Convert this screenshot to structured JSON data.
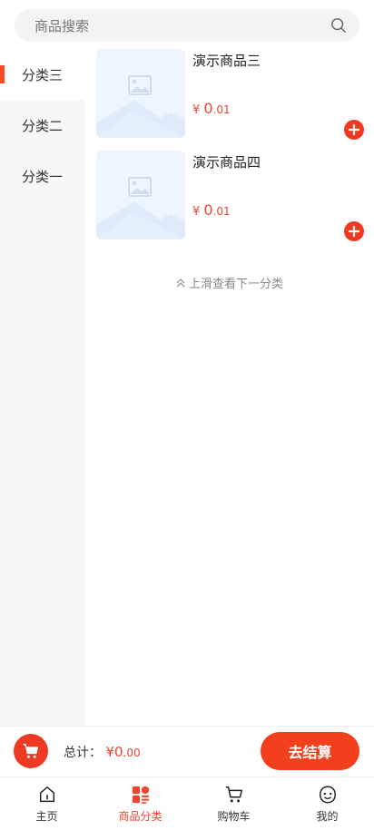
{
  "search": {
    "placeholder": "商品搜索",
    "icon": "search-icon"
  },
  "sidebar": {
    "items": [
      {
        "label": "分类三",
        "active": true
      },
      {
        "label": "分类二",
        "active": false
      },
      {
        "label": "分类一",
        "active": false
      }
    ]
  },
  "products": [
    {
      "name": "演示商品三",
      "currency": "¥",
      "price_int": "0",
      "price_dec": ".01"
    },
    {
      "name": "演示商品四",
      "currency": "¥",
      "price_int": "0",
      "price_dec": ".01"
    }
  ],
  "hint": "上滑查看下一分类",
  "cart": {
    "total_label": "总计：",
    "currency": "¥",
    "total_int": "0",
    "total_dec": ".00",
    "checkout_label": "去结算"
  },
  "tabs": [
    {
      "label": "主页",
      "icon": "home-icon",
      "active": false
    },
    {
      "label": "商品分类",
      "icon": "category-icon",
      "active": true
    },
    {
      "label": "购物车",
      "icon": "cart-icon",
      "active": false
    },
    {
      "label": "我的",
      "icon": "profile-icon",
      "active": false
    }
  ],
  "colors": {
    "accent": "#ee3a22",
    "sidebar_bg": "#f7f6f8",
    "thumb_bg": "#eef5fe"
  }
}
